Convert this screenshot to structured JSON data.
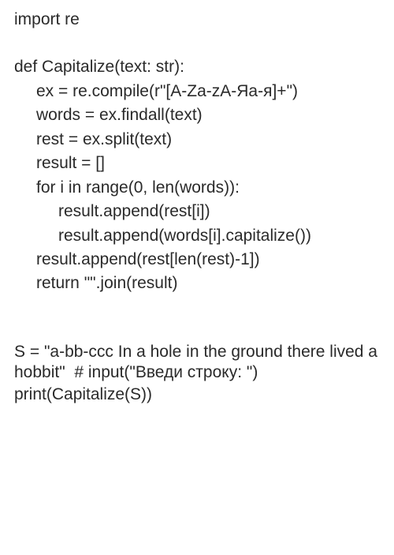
{
  "code": {
    "l1": "import re",
    "l2": "def Capitalize(text: str):",
    "l3": "ex = re.compile(r\"[A-Za-zА-Яа-я]+\")",
    "l4": "words = ex.findall(text)",
    "l5": "rest = ex.split(text)",
    "l6": "result = []",
    "l7": "for i in range(0, len(words)):",
    "l8": "result.append(rest[i])",
    "l9": "result.append(words[i].capitalize())",
    "l10": "result.append(rest[len(rest)-1])",
    "l11": "return \"\".join(result)",
    "l12": "S = \"a-bb-ccc In a hole in the ground there lived a hobbit\"  # input(\"Введи строку: \")",
    "l13": "print(Capitalize(S))"
  }
}
